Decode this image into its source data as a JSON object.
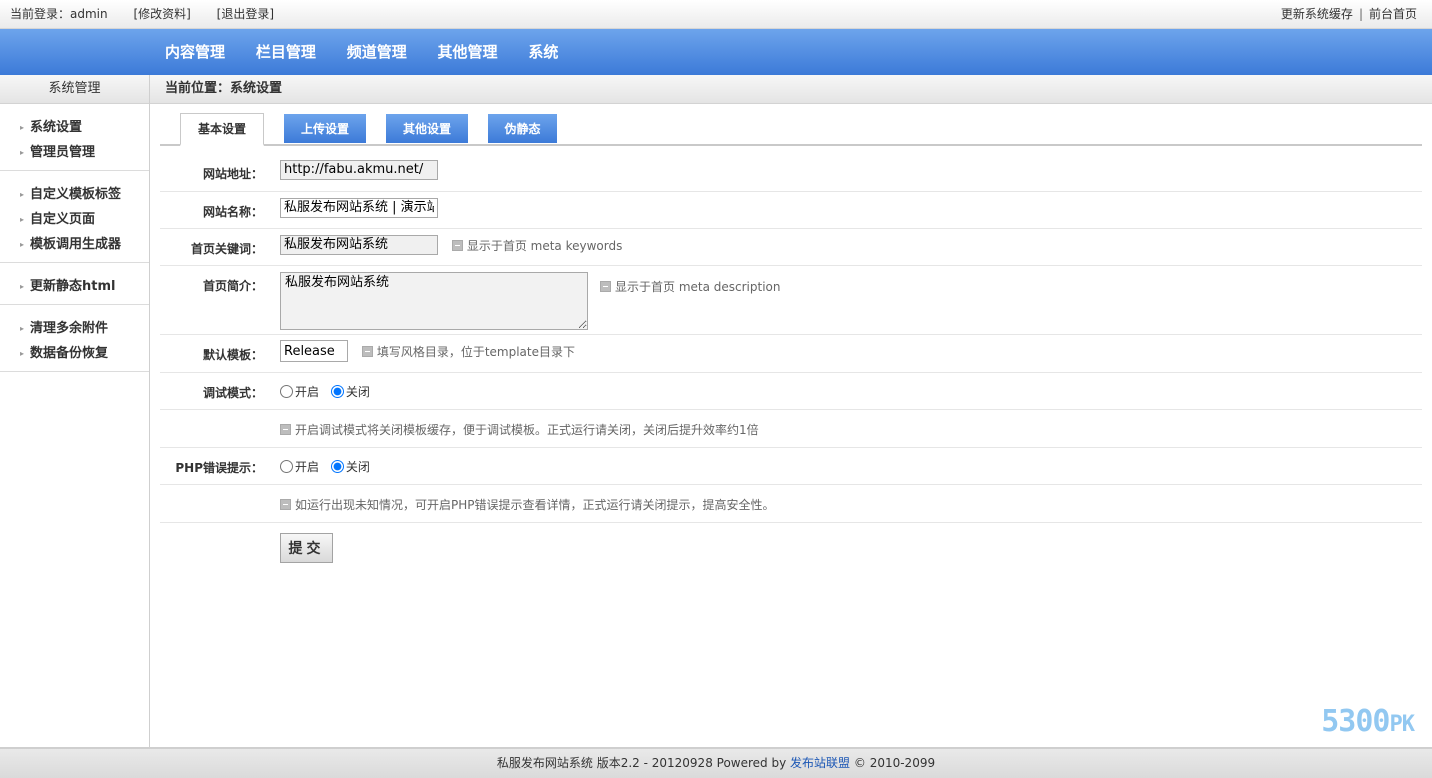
{
  "topbar": {
    "login_label": "当前登录：admin",
    "edit_profile": "[修改资料]",
    "logout": "[退出登录]",
    "clear_cache": "更新系统缓存",
    "separator": "|",
    "frontend": "前台首页"
  },
  "nav": {
    "items": [
      "内容管理",
      "栏目管理",
      "频道管理",
      "其他管理",
      "系统"
    ]
  },
  "sidebar": {
    "title": "系统管理",
    "groups": [
      [
        "系统设置",
        "管理员管理"
      ],
      [
        "自定义模板标签",
        "自定义页面",
        "模板调用生成器"
      ],
      [
        "更新静态html"
      ],
      [
        "清理多余附件",
        "数据备份恢复"
      ]
    ]
  },
  "breadcrumb": "当前位置：系统设置",
  "tabs": [
    "基本设置",
    "上传设置",
    "其他设置",
    "伪静态"
  ],
  "form": {
    "site_url": {
      "label": "网站地址：",
      "value": "http://fabu.akmu.net/"
    },
    "site_name": {
      "label": "网站名称：",
      "value": "私服发布网站系统 | 演示站"
    },
    "keywords": {
      "label": "首页关键词：",
      "value": "私服发布网站系统",
      "hint": "显示于首页 meta keywords"
    },
    "description": {
      "label": "首页简介：",
      "value": "私服发布网站系统",
      "hint": "显示于首页 meta description"
    },
    "template": {
      "label": "默认模板：",
      "value": "Release",
      "hint": "填写风格目录，位于template目录下"
    },
    "debug": {
      "label": "调试模式：",
      "on": "开启",
      "off": "关闭",
      "hint": "开启调试模式将关闭模板缓存，便于调试模板。正式运行请关闭，关闭后提升效率约1倍"
    },
    "php_error": {
      "label": "PHP错误提示：",
      "on": "开启",
      "off": "关闭",
      "hint": "如运行出现未知情况，可开启PHP错误提示查看详情，正式运行请关闭提示，提高安全性。"
    },
    "submit": "提交"
  },
  "footer": {
    "text": "私服发布网站系统 版本2.2 - 20120928 Powered by",
    "link": "发布站联盟",
    "copyright": "© 2010-2099"
  },
  "watermark": {
    "main": "5300",
    "suffix": "PK"
  }
}
